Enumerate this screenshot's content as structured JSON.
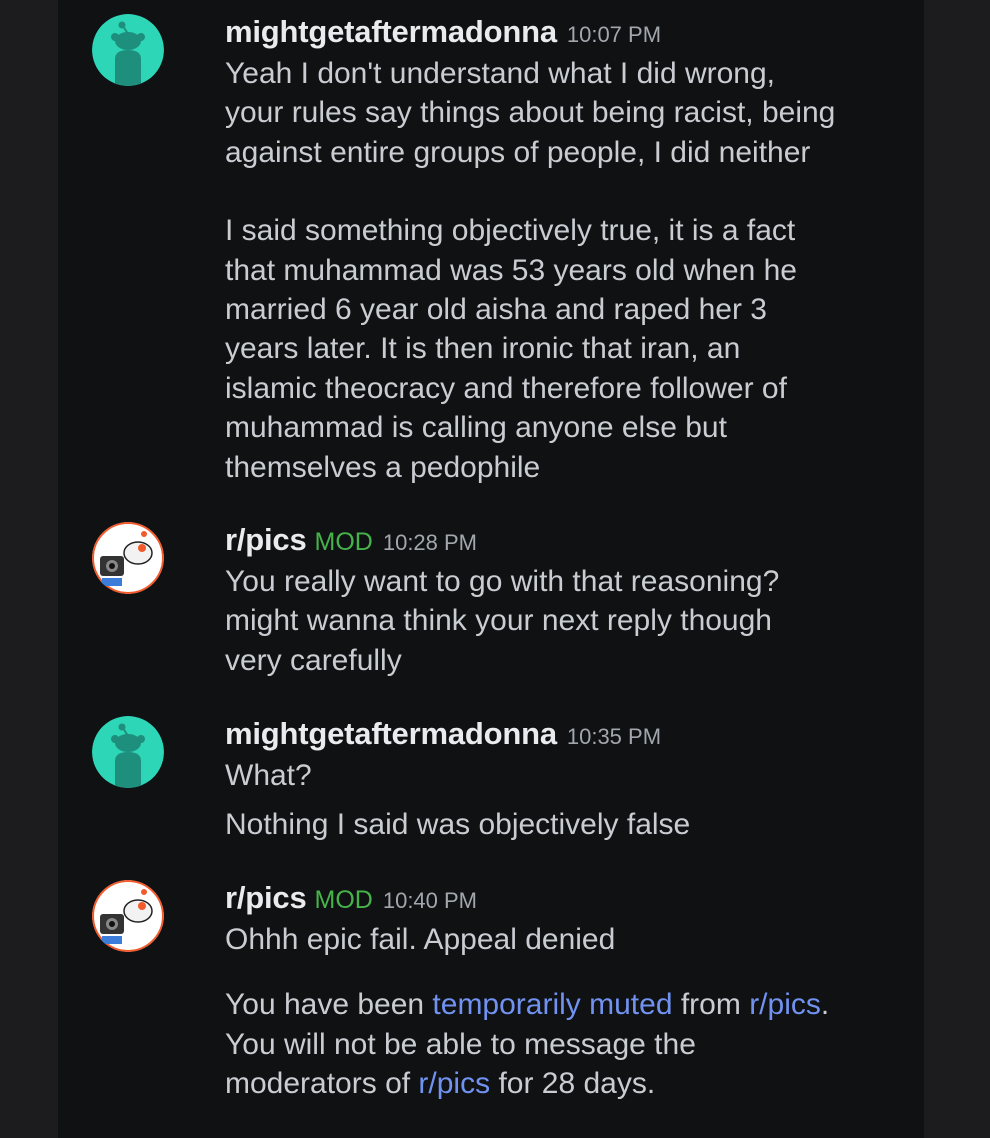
{
  "messages": [
    {
      "author": "mightgetaftermadonna",
      "time": "10:07 PM",
      "avatar_color": "#2dd6b6",
      "paragraphs": [
        "Yeah I don't understand what I did wrong,\nyour rules say things about being racist, being\nagainst entire groups of people, I did neither",
        "I said something objectively true, it is a fact\nthat muhammad was 53 years old when he\nmarried 6 year old aisha and raped her 3\nyears later. It is then ironic that iran, an\nislamic theocracy and therefore follower of\nmuhammad is calling anyone else but\nthemselves a pedophile"
      ]
    },
    {
      "author": "r/pics",
      "badge": "MOD",
      "time": "10:28 PM",
      "paragraphs": [
        "You really want to go with that reasoning?\nmight wanna think your next reply though\nvery carefully"
      ]
    },
    {
      "author": "mightgetaftermadonna",
      "time": "10:35 PM",
      "avatar_color": "#2dd6b6",
      "paragraphs": [
        "What?",
        "Nothing I said was objectively false"
      ]
    },
    {
      "author": "r/pics",
      "badge": "MOD",
      "time": "10:40 PM",
      "paragraphs": [
        "Ohhh epic fail. Appeal denied"
      ],
      "notice": {
        "p1": "You have been ",
        "link1": "temporarily muted",
        "p2": " from ",
        "link2": "r/pics",
        "p3": ".\nYou will not be able to message the\nmoderators of ",
        "link3": "r/pics",
        "p4": " for 28 days."
      }
    }
  ],
  "colors": {
    "background": "#0f1113",
    "text": "#c9cdd2",
    "mod": "#46b34a",
    "link": "#7192f0"
  }
}
